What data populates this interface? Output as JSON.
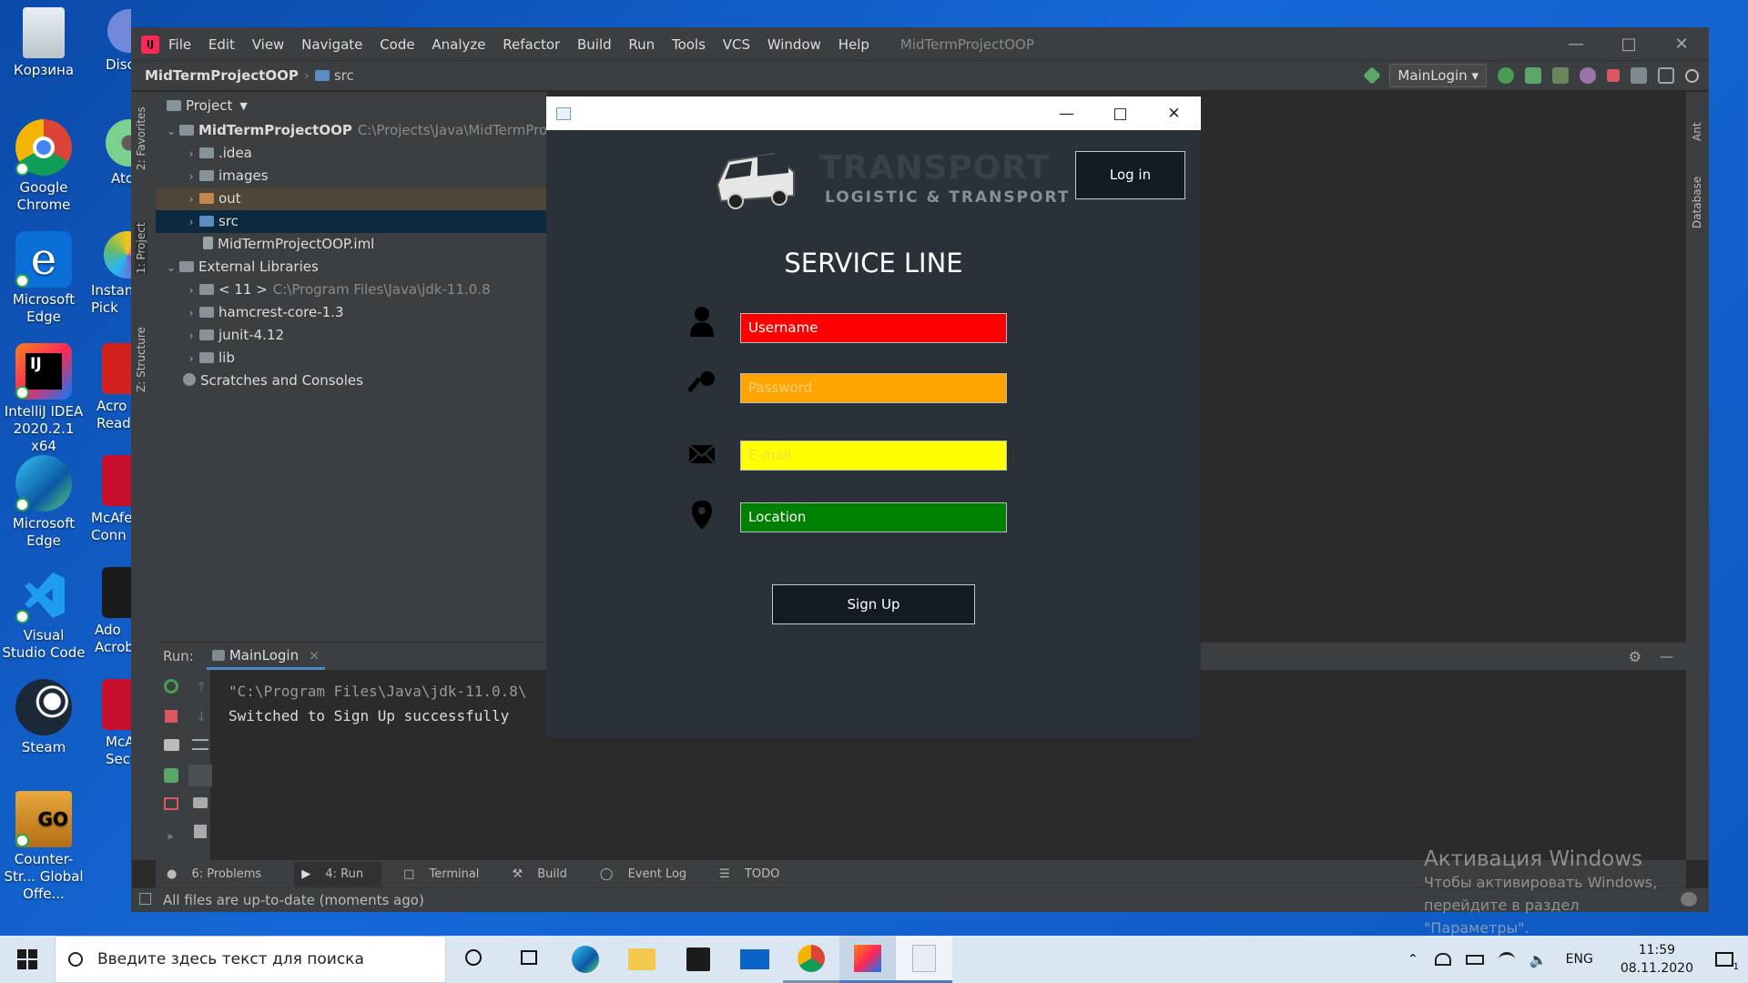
{
  "desktop": {
    "icons": [
      {
        "label": "Корзина"
      },
      {
        "label": "Google Chrome"
      },
      {
        "label": "Microsoft Edge"
      },
      {
        "label": "IntelliJ IDEA 2020.2.1 x64"
      },
      {
        "label": "Microsoft Edge"
      },
      {
        "label": "Visual Studio Code"
      },
      {
        "label": "Steam"
      },
      {
        "label": "Counter-Str... Global Offe..."
      },
      {
        "label": "Disc"
      },
      {
        "label": "Ato"
      },
      {
        "label": "Instant Pick"
      },
      {
        "label": "Acro Reade"
      },
      {
        "label": "McAfe Conn"
      },
      {
        "label": "Ado Acrob"
      },
      {
        "label": "McA Securi"
      }
    ]
  },
  "ide": {
    "menu": [
      "File",
      "Edit",
      "View",
      "Navigate",
      "Code",
      "Analyze",
      "Refactor",
      "Build",
      "Run",
      "Tools",
      "VCS",
      "Window",
      "Help"
    ],
    "project_title": "MidTermProjectOOP",
    "breadcrumb": {
      "root": "MidTermProjectOOP",
      "child": "src"
    },
    "run_config": "MainLogin",
    "side_tabs": {
      "favorites": "2: Favorites",
      "project": "1: Project",
      "structure": "Z: Structure",
      "ant": "Ant",
      "database": "Database"
    },
    "project_panel": {
      "header": "Project",
      "tree": [
        {
          "label": "MidTermProjectOOP",
          "path": "C:\\Projects\\Java\\MidTermProjectO"
        },
        {
          "label": ".idea"
        },
        {
          "label": "images"
        },
        {
          "label": "out"
        },
        {
          "label": "src"
        },
        {
          "label": "MidTermProjectOOP.iml"
        },
        {
          "label": "External Libraries"
        },
        {
          "label": "< 11 >",
          "path": "C:\\Program Files\\Java\\jdk-11.0.8"
        },
        {
          "label": "hamcrest-core-1.3"
        },
        {
          "label": "junit-4.12"
        },
        {
          "label": "lib"
        },
        {
          "label": "Scratches and Consoles"
        }
      ]
    },
    "run_panel": {
      "label": "Run:",
      "tab": "MainLogin",
      "output": [
        "\"C:\\Program Files\\Java\\jdk-11.0.8\\",
        "Switched to Sign Up successfully"
      ]
    },
    "bottom_tabs": [
      "6: Problems",
      "4: Run",
      "Terminal",
      "Build",
      "Event Log",
      "TODO"
    ],
    "status": "All files are up-to-date (moments ago)"
  },
  "app": {
    "brand_main": "TRANSPORT",
    "brand_sub": "LOGISTIC & TRANSPORT",
    "login_button": "Log in",
    "heading": "SERVICE LINE",
    "fields": [
      {
        "placeholder": "Username",
        "color": "#ff0000"
      },
      {
        "placeholder": "Password",
        "color": "#ffa500"
      },
      {
        "placeholder": "E-mail",
        "color": "#ffff00"
      },
      {
        "placeholder": "Location",
        "color": "#008000"
      }
    ],
    "signup_button": "Sign Up"
  },
  "activation": {
    "title": "Активация Windows",
    "line1": "Чтобы активировать Windows, перейдите в раздел",
    "line2": "\"Параметры\"."
  },
  "taskbar": {
    "search_placeholder": "Введите здесь текст для поиска",
    "lang": "ENG",
    "time": "11:59",
    "date": "08.11.2020"
  }
}
